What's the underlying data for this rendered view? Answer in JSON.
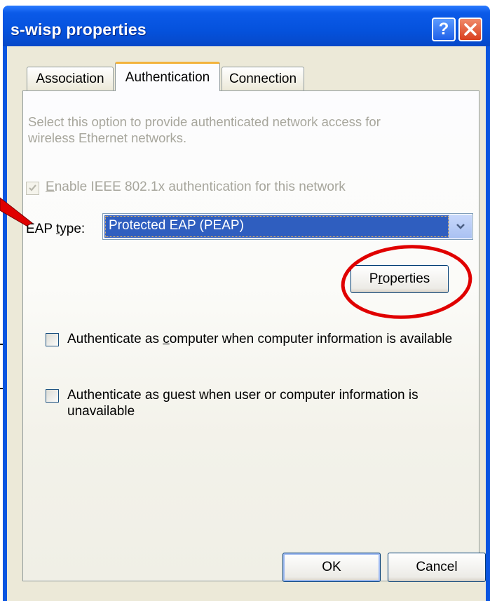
{
  "window": {
    "title": "s-wisp properties"
  },
  "tabs": [
    {
      "label": "Association"
    },
    {
      "label": "Authentication"
    },
    {
      "label": "Connection"
    }
  ],
  "description": "Select this option to provide authenticated network access for wireless Ethernet networks.",
  "ieee": {
    "pre": "",
    "mnemonic": "E",
    "post": "nable IEEE 802.1x authentication for this network",
    "checked": true,
    "disabled": true
  },
  "eap": {
    "label_pre": "EAP ",
    "label_mnemonic": "t",
    "label_post": "ype:",
    "value": "Protected EAP (PEAP)"
  },
  "properties_button": {
    "pre": "P",
    "mnemonic": "r",
    "post": "operties"
  },
  "auth_computer": {
    "pre": "Authenticate as ",
    "mnemonic": "c",
    "post": "omputer when computer information is available",
    "checked": false
  },
  "auth_guest": {
    "pre": "Authenticate as ",
    "mnemonic": "g",
    "post": "uest when user or computer information is unavailable",
    "checked": false
  },
  "buttons": {
    "ok": "OK",
    "cancel": "Cancel"
  },
  "colors": {
    "annotation": "#e00000",
    "title_bar": "#0552dd",
    "selection": "#2f5ebf",
    "dialog_bg": "#ece9d8"
  },
  "icons": [
    "help-icon",
    "close-icon",
    "checkmark-icon",
    "dropdown-arrow-icon"
  ]
}
